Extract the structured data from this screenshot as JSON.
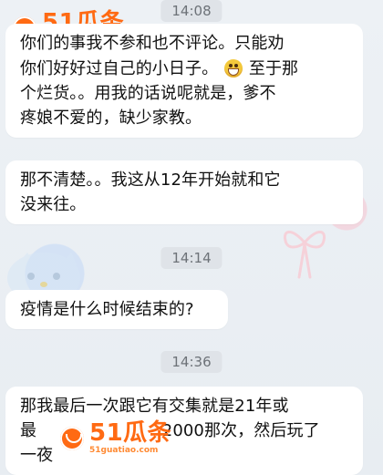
{
  "chat": {
    "timestamps": [
      "14:08",
      "14:14",
      "14:36"
    ],
    "messages": [
      {
        "lines": [
          "你们的事我不参和也不评论。只能劝",
          "你们好好过自己的小日子。",
          "至于那",
          "个烂货。。用我的话说呢就是，爹不",
          "疼娘不爱的，缺少家教。"
        ],
        "emoji": "grinning-face"
      },
      {
        "lines": [
          "那不清楚。。我这从12年开始就和它",
          "没来往。"
        ]
      },
      {
        "lines": [
          "疫情是什么时候结束的?"
        ]
      },
      {
        "lines": [
          "那我最后一次跟它有交集就是21年或",
          "最",
          "2000那次，然后玩了",
          "一夜"
        ]
      }
    ]
  },
  "watermark": {
    "main": "51瓜条",
    "sub": "51guatiao.com",
    "color": "#ff6a13"
  },
  "background": {
    "color": "#e9eef3"
  }
}
